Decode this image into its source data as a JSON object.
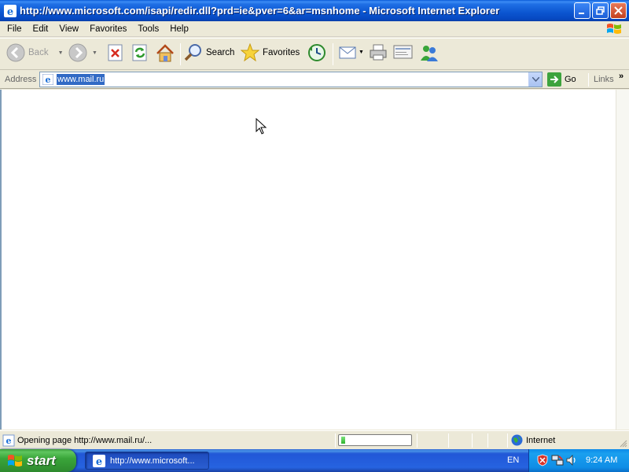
{
  "window": {
    "title": "http://www.microsoft.com/isapi/redir.dll?prd=ie&pver=6&ar=msnhome - Microsoft Internet Explorer"
  },
  "menu": {
    "items": [
      "File",
      "Edit",
      "View",
      "Favorites",
      "Tools",
      "Help"
    ]
  },
  "toolbar": {
    "back_label": "Back",
    "search_label": "Search",
    "favorites_label": "Favorites",
    "icons": [
      "back-icon",
      "forward-icon",
      "stop-icon",
      "refresh-icon",
      "home-icon",
      "search-icon",
      "favorites-icon",
      "history-icon",
      "mail-icon",
      "print-icon",
      "edit-icon",
      "messenger-icon"
    ]
  },
  "address": {
    "label": "Address",
    "value": "www.mail.ru",
    "go_label": "Go",
    "links_label": "Links"
  },
  "status": {
    "text": "Opening page http://www.mail.ru/...",
    "progress_fraction": 0.06,
    "zone": "Internet"
  },
  "taskbar": {
    "start_label": "start",
    "task_label": "http://www.microsoft...",
    "language": "EN",
    "clock": "9:24 AM"
  },
  "colors": {
    "titlebar": "#0b55d0",
    "taskbar": "#2663e0",
    "start": "#3aa53a",
    "selection": "#316ac5"
  }
}
